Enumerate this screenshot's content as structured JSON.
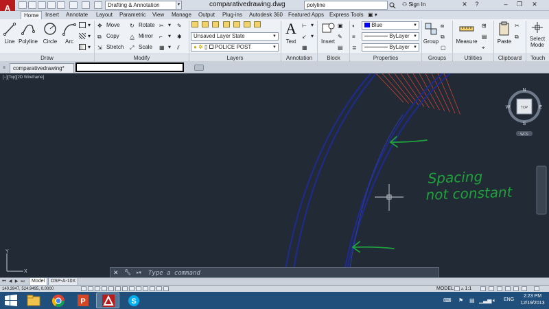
{
  "app": {
    "logo_letter": "A",
    "workspace": "Drafting & Annotation",
    "document_title": "comparativedrawing.dwg",
    "search_value": "polyline",
    "signin_label": "Sign In",
    "help_label": "?"
  },
  "tabs": [
    "Home",
    "Insert",
    "Annotate",
    "Layout",
    "Parametric",
    "View",
    "Manage",
    "Output",
    "Plug-ins",
    "Autodesk 360",
    "Featured Apps",
    "Express Tools"
  ],
  "ribbon": {
    "draw": {
      "title": "Draw",
      "tools": [
        "Line",
        "Polyline",
        "Circle",
        "Arc"
      ]
    },
    "modify": {
      "title": "Modify",
      "tools": [
        "Move",
        "Rotate",
        "Copy",
        "Mirror",
        "Stretch",
        "Scale"
      ]
    },
    "layers": {
      "title": "Layers",
      "layer_state": "Unsaved Layer State",
      "current_layer": "POLICE POST"
    },
    "annotation": {
      "title": "Annotation",
      "text_label": "Text"
    },
    "block": {
      "title": "Block",
      "insert_label": "Insert"
    },
    "properties": {
      "title": "Properties",
      "color": "Blue",
      "linetype": "ByLayer",
      "lineweight": "ByLayer"
    },
    "groups": {
      "title": "Groups",
      "group_label": "Group"
    },
    "utilities": {
      "title": "Utilities",
      "measure_label": "Measure"
    },
    "clipboard": {
      "title": "Clipboard",
      "paste_label": "Paste"
    },
    "touch": {
      "title": "Touch",
      "select_mode_label": "Select Mode"
    }
  },
  "file_tab": {
    "label": "comparativedrawing*"
  },
  "viewport": {
    "label": "[−][Top][2D Wireframe]",
    "viewcube": {
      "north": "N",
      "south": "S",
      "east": "E",
      "west": "W",
      "face": "TOP",
      "wcs": "WCS"
    }
  },
  "annotation_note": {
    "line1": "Spacing",
    "line2": "not constant"
  },
  "command_line": {
    "placeholder": "Type a command"
  },
  "layout_tabs": [
    "Model",
    "DSP-A-10X"
  ],
  "status": {
    "coordinates": "140.3947, 524.9495, 0.0000",
    "model_label": "MODEL",
    "scale_label": "1:1"
  },
  "taskbar": {
    "time": "2:23 PM",
    "date": "12/19/2013",
    "language": "ENG"
  },
  "colors": {
    "drawing_bg": "#222a36",
    "curve_blue": "#1e2b8a",
    "hatch_red": "#c9432f",
    "annotation_green": "#1fa13c"
  }
}
